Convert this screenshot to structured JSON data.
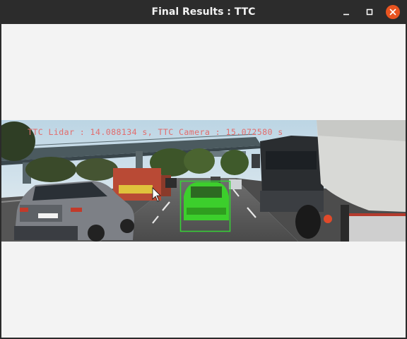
{
  "window": {
    "title": "Final Results : TTC",
    "controls": [
      "minimize-icon",
      "maximize-icon",
      "close-icon"
    ]
  },
  "image": {
    "overlay_text": "TTC Lidar : 14.088134 s, TTC Camera : 15.072580 s",
    "colors": {
      "overlay_text": "#e26d6d",
      "roi_box": "#36d336",
      "roi_fill": "#3ccf2c",
      "close_button": "#e95420"
    }
  }
}
